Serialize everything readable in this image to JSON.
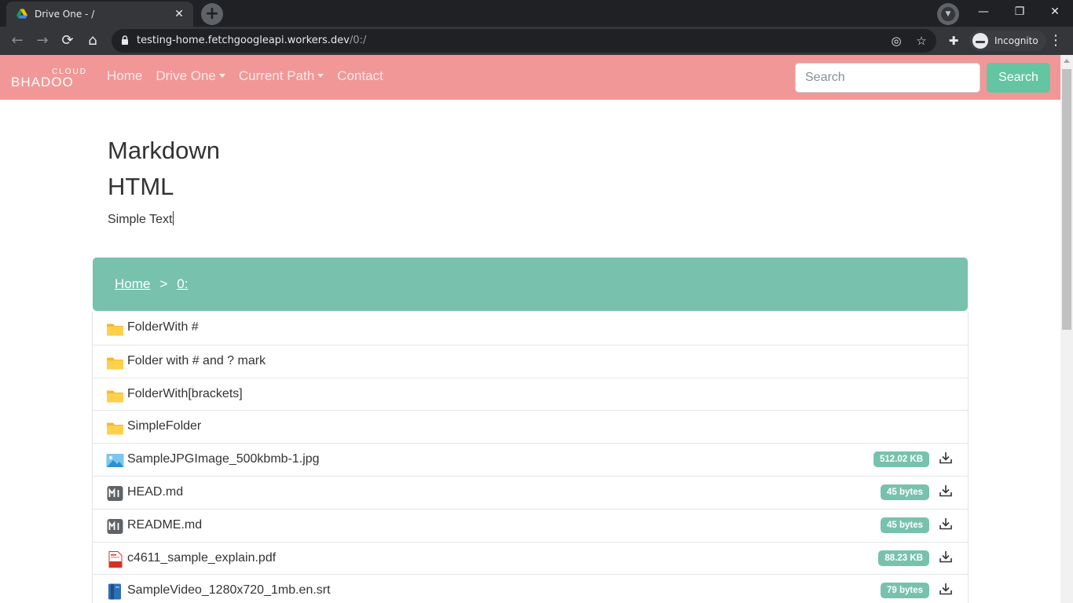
{
  "browser": {
    "tab_title": "Drive One - /",
    "tab_close": "✕",
    "new_tab": "+",
    "url_host": "testing-home.fetchgoogleapi.workers.dev",
    "url_path": "/0:/",
    "incognito_label": "Incognito",
    "window_controls": [
      "—",
      "❐",
      "✕"
    ],
    "icons": {
      "back": "←",
      "forward": "→",
      "reload": "⟳",
      "home": "⌂",
      "eye_off": "◎",
      "star": "☆",
      "extensions": "✚",
      "menu": "⋮"
    }
  },
  "navbar": {
    "brand_top": "CLOUD",
    "brand_name": "BHADOO",
    "links": [
      "Home",
      "Drive One",
      "Current Path",
      "Contact"
    ],
    "search_placeholder": "Search",
    "search_button": "Search",
    "colors": {
      "background": "#f19797",
      "accent": "#64c5a3"
    }
  },
  "content": {
    "heading1": "Markdown",
    "heading2": "HTML",
    "text": "Simple Text"
  },
  "breadcrumb": {
    "home": "Home",
    "separator": ">",
    "current": "0:"
  },
  "files": [
    {
      "name": "FolderWith #",
      "type": "folder",
      "size": null
    },
    {
      "name": "Folder with # and ? mark",
      "type": "folder",
      "size": null
    },
    {
      "name": "FolderWith[brackets]",
      "type": "folder",
      "size": null
    },
    {
      "name": "SimpleFolder",
      "type": "folder",
      "size": null
    },
    {
      "name": "SampleJPGImage_500kbmb-1.jpg",
      "type": "image",
      "size": "512.02 KB"
    },
    {
      "name": "HEAD.md",
      "type": "markdown",
      "size": "45 bytes"
    },
    {
      "name": "README.md",
      "type": "markdown",
      "size": "45 bytes"
    },
    {
      "name": "c4611_sample_explain.pdf",
      "type": "pdf",
      "size": "88.23 KB"
    },
    {
      "name": "SampleVideo_1280x720_1mb.en.srt",
      "type": "subtitle",
      "size": "79 bytes"
    }
  ]
}
